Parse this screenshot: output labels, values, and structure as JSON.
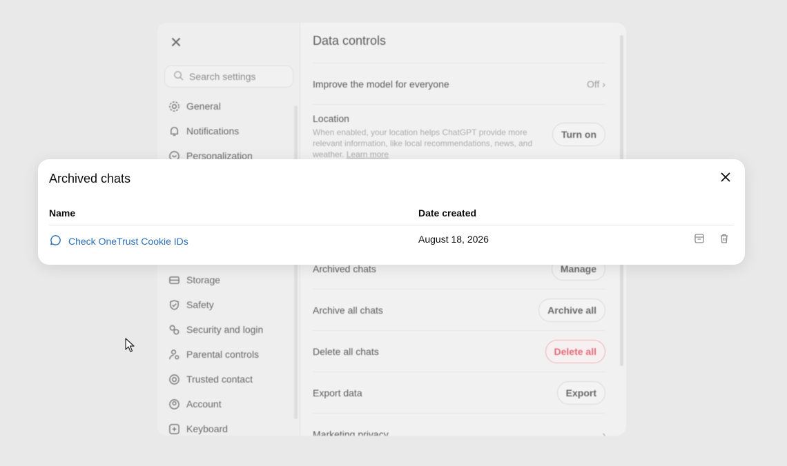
{
  "settings": {
    "search_placeholder": "Search settings",
    "nav": [
      {
        "label": "General",
        "icon": "gear-icon"
      },
      {
        "label": "Notifications",
        "icon": "bell-icon"
      },
      {
        "label": "Personalization",
        "icon": "personalization-icon"
      }
    ],
    "nav_lower": [
      {
        "label": "Storage",
        "icon": "storage-icon"
      },
      {
        "label": "Safety",
        "icon": "shield-icon"
      },
      {
        "label": "Security and login",
        "icon": "key-icon"
      },
      {
        "label": "Parental controls",
        "icon": "parental-icon"
      },
      {
        "label": "Trusted contact",
        "icon": "lifebuoy-icon"
      },
      {
        "label": "Account",
        "icon": "account-icon"
      },
      {
        "label": "Keyboard",
        "icon": "keyboard-icon"
      }
    ],
    "content": {
      "title": "Data controls",
      "improve_label": "Improve the model for everyone",
      "improve_value": "Off",
      "location_label": "Location",
      "location_desc": "When enabled, your location helps ChatGPT provide more relevant information, like local recommendations, news, and weather.",
      "learn_more": "Learn more",
      "location_button": "Turn on",
      "archived_label": "Archived chats",
      "archived_button": "Manage",
      "archive_all_label": "Archive all chats",
      "archive_all_button": "Archive all",
      "delete_all_label": "Delete all chats",
      "delete_all_button": "Delete all",
      "export_label": "Export data",
      "export_button": "Export",
      "marketing_label": "Marketing privacy"
    }
  },
  "modal": {
    "title": "Archived chats",
    "columns": {
      "name": "Name",
      "date": "Date created"
    },
    "rows": [
      {
        "name": "Check OneTrust Cookie IDs",
        "date": "August 18, 2026"
      }
    ]
  },
  "colors": {
    "link": "#2a6ebb",
    "danger": "#e0455a"
  }
}
